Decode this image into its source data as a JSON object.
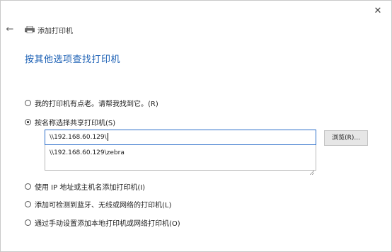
{
  "window": {
    "close_glyph": "✕",
    "header_title": "添加打印机",
    "back_glyph": "←"
  },
  "page_title": "按其他选项查找打印机",
  "options": [
    {
      "label": "我的打印机有点老。请帮我找到它。(R)",
      "checked": false
    },
    {
      "label": "按名称选择共享打印机(S)",
      "checked": true
    },
    {
      "label": "使用 IP 地址或主机名添加打印机(I)",
      "checked": false
    },
    {
      "label": "添加可检测到蓝牙、无线或网络的打印机(L)",
      "checked": false
    },
    {
      "label": "通过手动设置添加本地打印机或网络打印机(O)",
      "checked": false
    }
  ],
  "share_input": {
    "value": "\\\\192.168.60.129\\"
  },
  "suggestion": {
    "item": "\\\\192.168.60.129\\zebra"
  },
  "browse_button": {
    "label": "浏览(R)..."
  },
  "colors": {
    "title_blue": "#1a5fb4",
    "input_border": "#2a6dc9"
  }
}
